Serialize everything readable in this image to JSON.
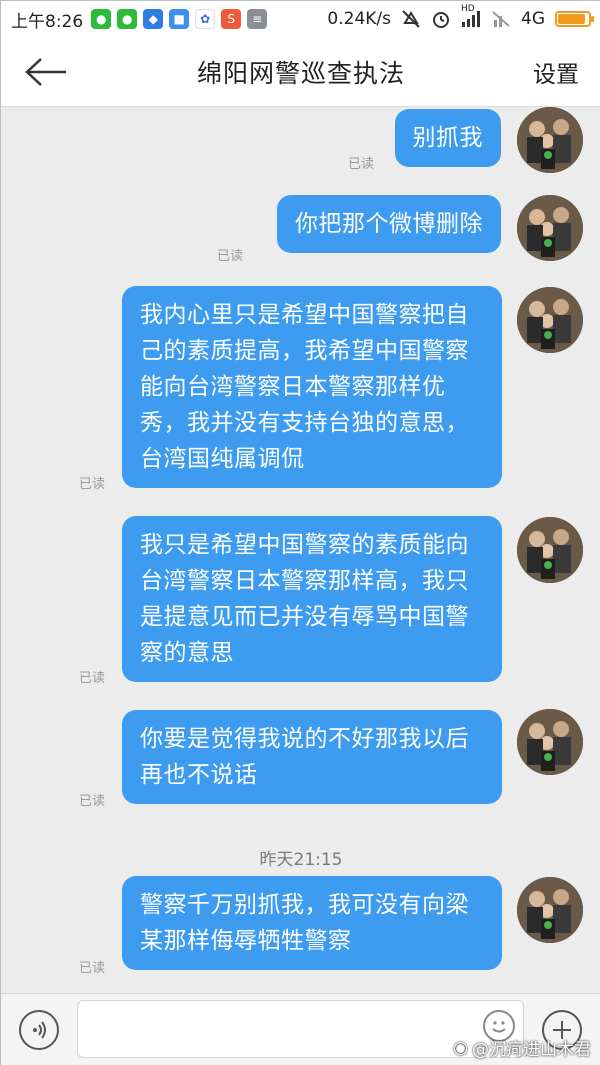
{
  "status_bar": {
    "time": "上午8:26",
    "speed": "0.24K/s",
    "network": "4G",
    "hd_label": "HD",
    "battery_level": 0.9,
    "app_icons": [
      "wechat-icon",
      "wechat-icon",
      "shield-icon",
      "app-icon",
      "baidu-icon",
      "weibo-icon",
      "notes-icon"
    ]
  },
  "header": {
    "title": "绵阳网警巡查执法",
    "settings_label": "设置"
  },
  "messages": [
    {
      "text": "别抓我",
      "read_label": "已读"
    },
    {
      "text": "你把那个微博删除",
      "read_label": "已读"
    },
    {
      "text": "我内心里只是希望中国警察把自己的素质提高，我希望中国警察能向台湾警察日本警察那样优秀，我并没有支持台独的意思，台湾国纯属调侃",
      "read_label": "已读"
    },
    {
      "text": "我只是希望中国警察的素质能向台湾警察日本警察那样高，我只是提意见而已并没有辱骂中国警察的意思",
      "read_label": "已读"
    },
    {
      "text": "你要是觉得我说的不好那我以后再也不说话",
      "read_label": "已读"
    },
    {
      "text": "警察千万别抓我，我可没有向梁某那样侮辱牺牲警察",
      "read_label": "已读"
    }
  ],
  "timestamp": "昨天21:15",
  "input": {
    "value": "",
    "placeholder": ""
  },
  "watermark": "@沉疴进山木君",
  "colors": {
    "bubble": "#3d9cf0",
    "chat_bg": "#ececec",
    "battery": "#f39a1e"
  }
}
